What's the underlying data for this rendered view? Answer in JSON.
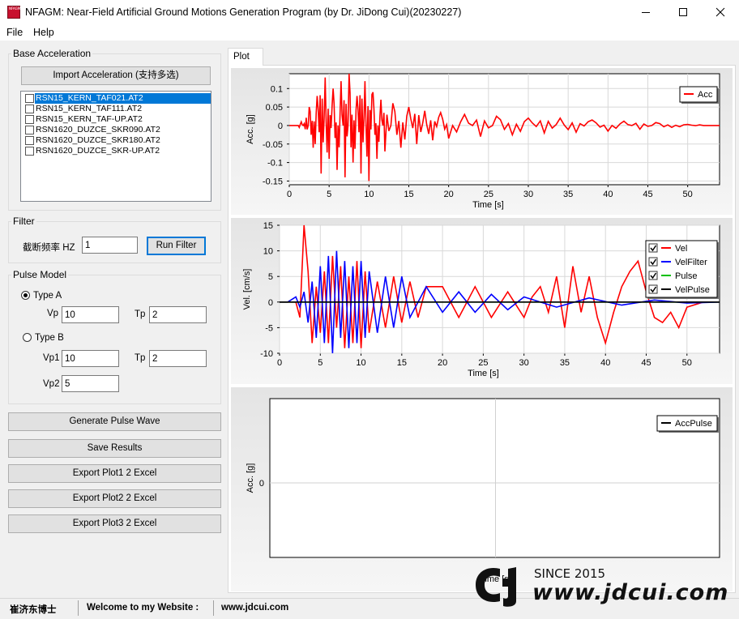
{
  "window": {
    "title": "NFAGM: Near-Field Artificial Ground Motions Generation Program (by Dr. JiDong Cui)(20230227)",
    "icon_text": "NFAGM",
    "controls": [
      "minimize-icon",
      "maximize-icon",
      "close-icon"
    ]
  },
  "menu": {
    "items": [
      "File",
      "Help"
    ]
  },
  "base_acceleration": {
    "title": "Base Acceleration",
    "import_button": "Import Acceleration (支持多选)",
    "files": [
      {
        "name": "RSN15_KERN_TAF021.AT2",
        "selected": true
      },
      {
        "name": "RSN15_KERN_TAF111.AT2",
        "selected": false
      },
      {
        "name": "RSN15_KERN_TAF-UP.AT2",
        "selected": false
      },
      {
        "name": "RSN1620_DUZCE_SKR090.AT2",
        "selected": false
      },
      {
        "name": "RSN1620_DUZCE_SKR180.AT2",
        "selected": false
      },
      {
        "name": "RSN1620_DUZCE_SKR-UP.AT2",
        "selected": false
      }
    ]
  },
  "filter": {
    "title": "Filter",
    "cutoff_label": "截断频率 HZ",
    "cutoff_value": "1",
    "run_button": "Run Filter"
  },
  "pulse_model": {
    "title": "Pulse Model",
    "type_a_label": "Type A",
    "type_b_label": "Type B",
    "selected_type": "Type A",
    "type_a": {
      "vp_label": "Vp",
      "vp_value": "10",
      "tp_label": "Tp",
      "tp_value": "2"
    },
    "type_b": {
      "vp1_label": "Vp1",
      "vp1_value": "10",
      "tp_label": "Tp",
      "tp_value": "2",
      "vp2_label": "Vp2",
      "vp2_value": "5"
    }
  },
  "actions": {
    "generate": "Generate Pulse Wave",
    "save": "Save Results",
    "export1": "Export Plot1 2 Excel",
    "export2": "Export Plot2 2 Excel",
    "export3": "Export Plot3 2 Excel"
  },
  "tabs": [
    {
      "label": "Plot",
      "active": true
    }
  ],
  "chart_data": [
    {
      "type": "line",
      "xlabel": "Time [s]",
      "ylabel": "Acc. [g]",
      "xlim": [
        0,
        54
      ],
      "ylim": [
        -0.16,
        0.14
      ],
      "xticks": [
        "0",
        "5",
        "10",
        "15",
        "20",
        "25",
        "30",
        "35",
        "40",
        "45",
        "50"
      ],
      "yticks": [
        "0.1",
        "0.05",
        "0",
        "-0.05",
        "-0.1",
        "-0.15"
      ],
      "ytick_values": [
        0.1,
        0.05,
        0,
        -0.05,
        -0.1,
        -0.15
      ],
      "grid": true,
      "legend_position": "top-right",
      "series": [
        {
          "name": "Acc",
          "color": "#ff0000",
          "x": [
            0,
            1,
            1.5,
            2,
            2.5,
            3,
            3.5,
            4,
            4.5,
            5,
            5.5,
            6,
            6.5,
            7,
            7.5,
            8,
            8.5,
            9,
            9.5,
            10,
            10.5,
            11,
            11.5,
            12,
            13,
            14,
            15,
            16,
            17,
            18,
            19,
            20,
            22,
            24,
            26,
            28,
            30,
            32,
            34,
            36,
            38,
            40,
            42,
            44,
            46,
            48,
            50,
            52,
            54
          ],
          "y": [
            0,
            0,
            0.01,
            -0.01,
            0.05,
            -0.06,
            0.08,
            -0.13,
            0.13,
            -0.09,
            0.1,
            -0.12,
            0.12,
            -0.14,
            0.14,
            -0.1,
            0.08,
            -0.13,
            0.12,
            -0.15,
            0.09,
            -0.09,
            0.07,
            -0.07,
            0.06,
            -0.06,
            0.05,
            -0.05,
            0.04,
            -0.04,
            0.035,
            -0.035,
            0.03,
            -0.03,
            0.025,
            -0.025,
            0.02,
            -0.02,
            0.02,
            -0.018,
            0.015,
            -0.015,
            0.012,
            -0.01,
            0.008,
            -0.005,
            0.003,
            0,
            0
          ]
        }
      ]
    },
    {
      "type": "line",
      "xlabel": "Time [s]",
      "ylabel": "Vel. [cm/s]",
      "xlim": [
        0,
        54
      ],
      "ylim": [
        -10,
        15
      ],
      "xticks": [
        "0",
        "5",
        "10",
        "15",
        "20",
        "25",
        "30",
        "35",
        "40",
        "45",
        "50"
      ],
      "yticks": [
        "15",
        "10",
        "5",
        "0",
        "-5",
        "-10"
      ],
      "ytick_values": [
        15,
        10,
        5,
        0,
        -5,
        -10
      ],
      "grid": true,
      "legend_position": "top-right",
      "series": [
        {
          "name": "Vel",
          "color": "#ff0000",
          "checked": true,
          "x": [
            0,
            2,
            2.5,
            3,
            3.5,
            4,
            4.5,
            5,
            5.5,
            6,
            6.5,
            7,
            7.5,
            8,
            8.5,
            9,
            9.5,
            10,
            10.5,
            11,
            12,
            13,
            14,
            15,
            16,
            17,
            18,
            20,
            22,
            24,
            26,
            28,
            30,
            31,
            32,
            33,
            34,
            35,
            36,
            37,
            38,
            39,
            40,
            41,
            42,
            43,
            44,
            45,
            46,
            47,
            48,
            49,
            50,
            52,
            54
          ],
          "y": [
            0,
            0,
            -3,
            15,
            6,
            -8,
            3,
            -6,
            6,
            -8,
            9,
            -5,
            7,
            -9,
            5,
            -8,
            8,
            -9,
            6,
            -6,
            4,
            -5,
            5,
            -4,
            4,
            -3,
            3,
            3,
            -3,
            3,
            -3,
            2,
            -3,
            1,
            3,
            -2,
            5,
            -5,
            7,
            -2,
            5,
            -3,
            -8,
            -2,
            3,
            6,
            8,
            2,
            -3,
            -4,
            -2,
            -5,
            -1,
            0,
            0
          ]
        },
        {
          "name": "VelFilter",
          "color": "#0000ff",
          "checked": true,
          "x": [
            0,
            1,
            2,
            2.5,
            3,
            3.5,
            4,
            4.5,
            5,
            5.5,
            6,
            6.5,
            7,
            7.5,
            8,
            8.5,
            9,
            9.5,
            10,
            10.5,
            11,
            12,
            13,
            14,
            15,
            16,
            18,
            20,
            22,
            24,
            26,
            28,
            30,
            34,
            38,
            42,
            46,
            50,
            54
          ],
          "y": [
            0,
            0,
            1,
            -1,
            2,
            -4,
            4,
            -7,
            7,
            -8,
            9,
            -10,
            10,
            -7,
            8,
            -9,
            7,
            -8,
            8,
            -7,
            6,
            -6,
            5,
            -5,
            5,
            -3,
            3,
            -2,
            2,
            -2,
            1.5,
            -1.5,
            1,
            -1,
            0.8,
            -0.6,
            0.4,
            -0.2,
            0
          ]
        },
        {
          "name": "Pulse",
          "color": "#00c000",
          "checked": true,
          "x": [
            0,
            54
          ],
          "y": [
            0,
            0
          ]
        },
        {
          "name": "VelPulse",
          "color": "#000000",
          "checked": true,
          "x": [
            0,
            54
          ],
          "y": [
            0,
            0
          ]
        }
      ]
    },
    {
      "type": "line",
      "xlabel": "Time [s]",
      "ylabel": "Acc. [g]",
      "yticks": [
        "0"
      ],
      "grid": true,
      "legend_position": "top-right",
      "series": [
        {
          "name": "AccPulse",
          "color": "#000000",
          "x": [],
          "y": []
        }
      ]
    }
  ],
  "statusbar": {
    "author": "崔济东博士",
    "welcome": "Welcome to my Website :",
    "website": "www.jdcui.com"
  },
  "watermark": {
    "since": "SINCE 2015",
    "url": "www.jdcui.com"
  }
}
